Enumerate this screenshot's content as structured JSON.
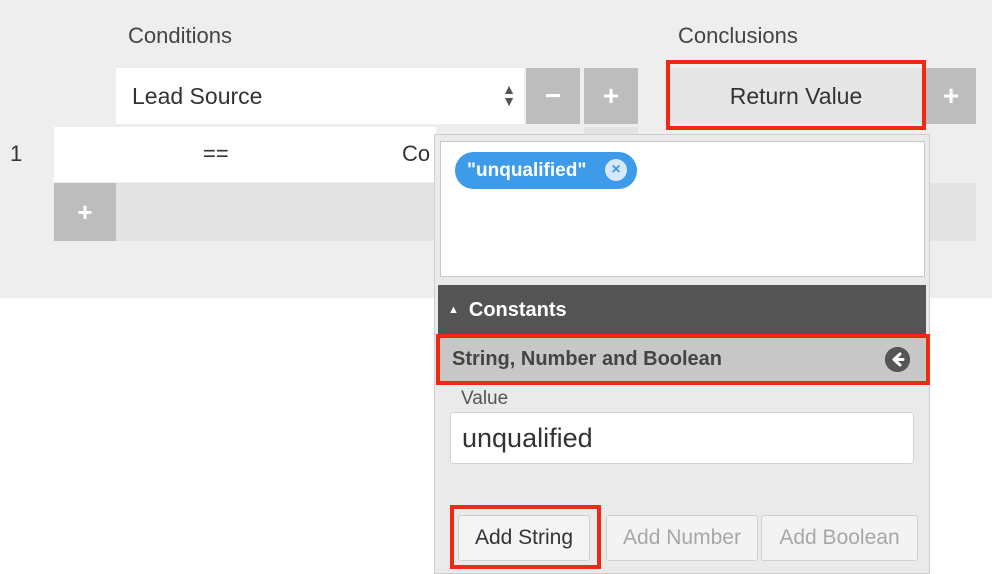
{
  "headers": {
    "conditions": "Conditions",
    "conclusions": "Conclusions"
  },
  "condition_row": {
    "field_select": "Lead Source",
    "remove_label": "−",
    "add_label": "+",
    "row_number": "1",
    "operator": "==",
    "value_truncated": "Co",
    "add_row_label": "+"
  },
  "conclusion": {
    "return_value_label": "Return Value",
    "add_label": "+"
  },
  "panel": {
    "token": "\"unqualified\"",
    "token_remove": "×",
    "constants_title": "Constants",
    "constants_toggle": "▲",
    "category_title": "String, Number and Boolean",
    "back_icon": "➔",
    "value_label": "Value",
    "value_input": "unqualified",
    "buttons": {
      "add_string": "Add String",
      "add_number": "Add Number",
      "add_boolean": "Add Boolean"
    }
  },
  "colors": {
    "highlight_border": "#ee2a13",
    "token_blue": "#3d9be9",
    "constants_bar": "#545454"
  }
}
